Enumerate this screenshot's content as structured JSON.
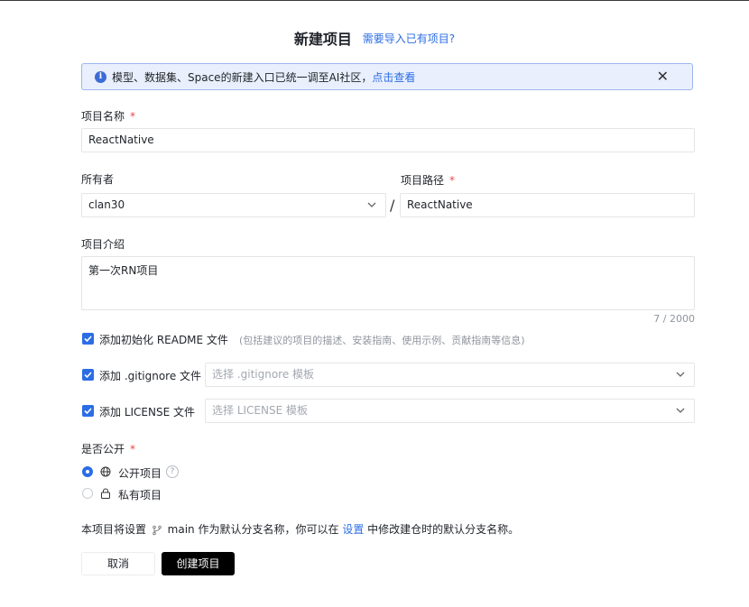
{
  "header": {
    "title": "新建项目",
    "import_link": "需要导入已有项目?"
  },
  "notice": {
    "text": "模型、数据集、Space的新建入口已统一调至AI社区，",
    "link": "点击查看",
    "close": "✕"
  },
  "fields": {
    "name": {
      "label": "项目名称",
      "required": "*",
      "value": "ReactNative"
    },
    "owner": {
      "label": "所有者",
      "value": "clan30"
    },
    "separator": "/",
    "path": {
      "label": "项目路径",
      "required": "*",
      "value": "ReactNative"
    },
    "description": {
      "label": "项目介绍",
      "value": "第一次RN项目",
      "counter": "7 / 2000"
    }
  },
  "options": {
    "readme": {
      "label": "添加初始化 README 文件",
      "hint": "(包括建议的项目的描述、安装指南、使用示例、贡献指南等信息)"
    },
    "gitignore": {
      "label": "添加 .gitignore 文件",
      "placeholder": "选择 .gitignore 模板"
    },
    "license": {
      "label": "添加 LICENSE 文件",
      "placeholder": "选择 LICENSE 模板"
    }
  },
  "visibility": {
    "label": "是否公开",
    "required": "*",
    "public": "公开项目",
    "help": "?",
    "private": "私有项目",
    "selected": "public"
  },
  "footnote": {
    "prefix": "本项目将设置",
    "branch": "main",
    "middle": "作为默认分支名称，你可以在",
    "link": "设置",
    "suffix": "中修改建仓时的默认分支名称。"
  },
  "buttons": {
    "cancel": "取消",
    "create": "创建项目"
  },
  "colors": {
    "accent": "#2b6de5",
    "notice_bg": "#e9effc",
    "required": "#e5484d",
    "primary_button": "#000000"
  },
  "icons": {
    "info": "info-icon",
    "close": "close-icon",
    "chevron": "chevron-down-icon",
    "checkbox": "check-icon",
    "globe": "globe-icon",
    "lock": "lock-icon",
    "help": "help-icon",
    "branch": "branch-icon"
  }
}
